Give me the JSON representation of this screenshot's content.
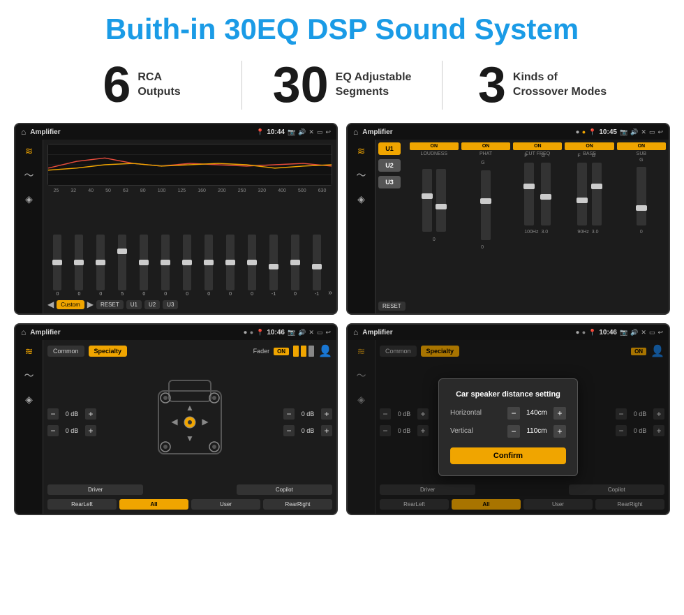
{
  "header": {
    "title": "Buith-in 30EQ DSP Sound System"
  },
  "stats": [
    {
      "number": "6",
      "label": "RCA\nOutputs"
    },
    {
      "number": "30",
      "label": "EQ Adjustable\nSegments"
    },
    {
      "number": "3",
      "label": "Kinds of\nCrossover Modes"
    }
  ],
  "screen1": {
    "status": {
      "title": "Amplifier",
      "time": "10:44"
    },
    "freq_labels": [
      "25",
      "32",
      "40",
      "50",
      "63",
      "80",
      "100",
      "125",
      "160",
      "200",
      "250",
      "320",
      "400",
      "500",
      "630"
    ],
    "slider_values": [
      "0",
      "0",
      "0",
      "5",
      "0",
      "0",
      "0",
      "0",
      "0",
      "0",
      "-1",
      "0",
      "-1"
    ],
    "buttons": [
      "Custom",
      "RESET",
      "U1",
      "U2",
      "U3"
    ]
  },
  "screen2": {
    "status": {
      "title": "Amplifier",
      "time": "10:45"
    },
    "presets": [
      "U1",
      "U2",
      "U3"
    ],
    "channels": [
      "LOUDNESS",
      "PHAT",
      "CUT FREQ",
      "BASS",
      "SUB"
    ],
    "channel_labels": [
      "ON",
      "ON",
      "ON",
      "ON",
      "ON"
    ]
  },
  "screen3": {
    "status": {
      "title": "Amplifier",
      "time": "10:46"
    },
    "tabs": [
      "Common",
      "Specialty"
    ],
    "active_tab": "Specialty",
    "fader_label": "Fader",
    "db_values": [
      "0 dB",
      "0 dB",
      "0 dB",
      "0 dB"
    ],
    "bottom_buttons": [
      "Driver",
      "",
      "Copilot",
      "RearLeft",
      "All",
      "User",
      "RearRight"
    ]
  },
  "screen4": {
    "status": {
      "title": "Amplifier",
      "time": "10:46"
    },
    "tabs": [
      "Common",
      "Specialty"
    ],
    "dialog": {
      "title": "Car speaker distance setting",
      "fields": [
        {
          "label": "Horizontal",
          "value": "140cm"
        },
        {
          "label": "Vertical",
          "value": "110cm"
        }
      ],
      "confirm_label": "Confirm"
    },
    "db_values": [
      "0 dB",
      "0 dB"
    ],
    "bottom_buttons": [
      "Driver",
      "Copilot",
      "RearLeft",
      "All",
      "User",
      "RearRight"
    ]
  },
  "icons": {
    "home": "⌂",
    "back": "↩",
    "eq": "≋",
    "wave": "〜",
    "speaker": "◈",
    "settings": "⚙",
    "person": "👤"
  }
}
